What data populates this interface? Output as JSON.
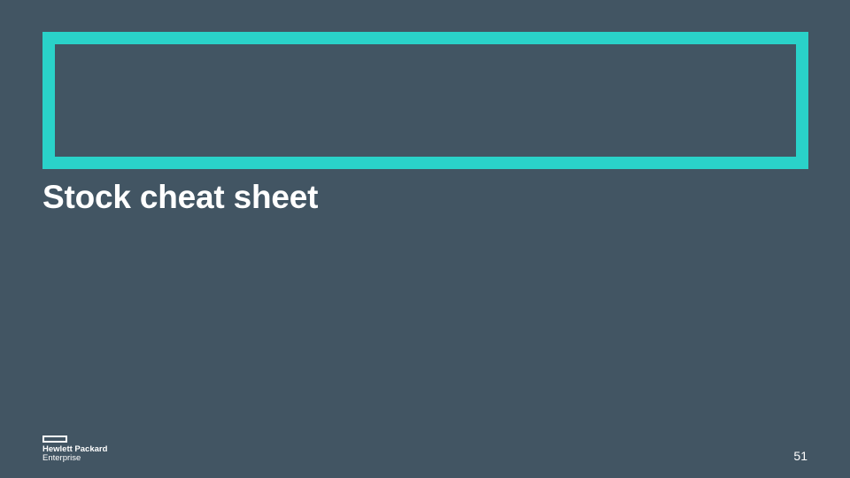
{
  "slide": {
    "title": "Stock cheat sheet",
    "page_number": "51"
  },
  "logo": {
    "line1": "Hewlett Packard",
    "line2": "Enterprise",
    "icon": "hpe-element-rectangle-icon"
  },
  "colors": {
    "background": "#425563",
    "accent": "#2ad2c9",
    "text": "#ffffff"
  }
}
